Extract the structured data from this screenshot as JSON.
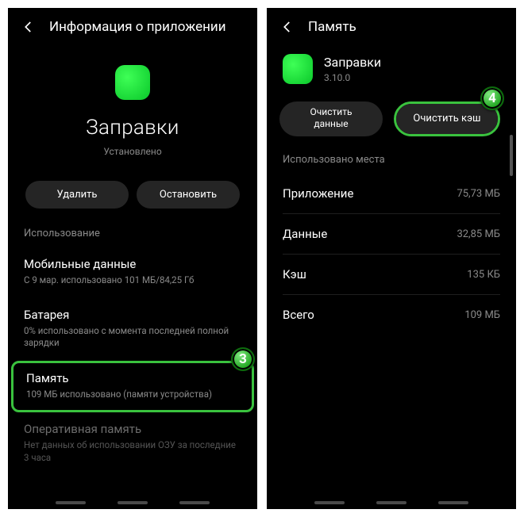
{
  "left": {
    "header_title": "Информация о приложении",
    "app_name": "Заправки",
    "installed": "Установлено",
    "btn_uninstall": "Удалить",
    "btn_stop": "Остановить",
    "section_usage": "Использование",
    "mobile_data": {
      "title": "Мобильные данные",
      "sub": "С 9 мар. использовано 101 МБ/84,25 Гб"
    },
    "battery": {
      "title": "Батарея",
      "sub": "0% использовано с момента последней полной зарядки"
    },
    "storage": {
      "title": "Память",
      "sub": "109 МБ использовано (памяти устройства)"
    },
    "ram": {
      "title": "Оперативная память",
      "sub": "Нет данных об использовании ОЗУ за последние 3 часа"
    }
  },
  "right": {
    "header_title": "Память",
    "app_name": "Заправки",
    "version": "3.10.0",
    "btn_clear_data": "Очистить данные",
    "btn_clear_cache": "Очистить кэш",
    "section_space": "Использовано места",
    "rows": {
      "app": {
        "k": "Приложение",
        "v": "75,73 МБ"
      },
      "data": {
        "k": "Данные",
        "v": "32,85 МБ"
      },
      "cache": {
        "k": "Кэш",
        "v": "135 КБ"
      },
      "total": {
        "k": "Всего",
        "v": "109 МБ"
      }
    }
  },
  "badges": {
    "three": "3",
    "four": "4"
  }
}
